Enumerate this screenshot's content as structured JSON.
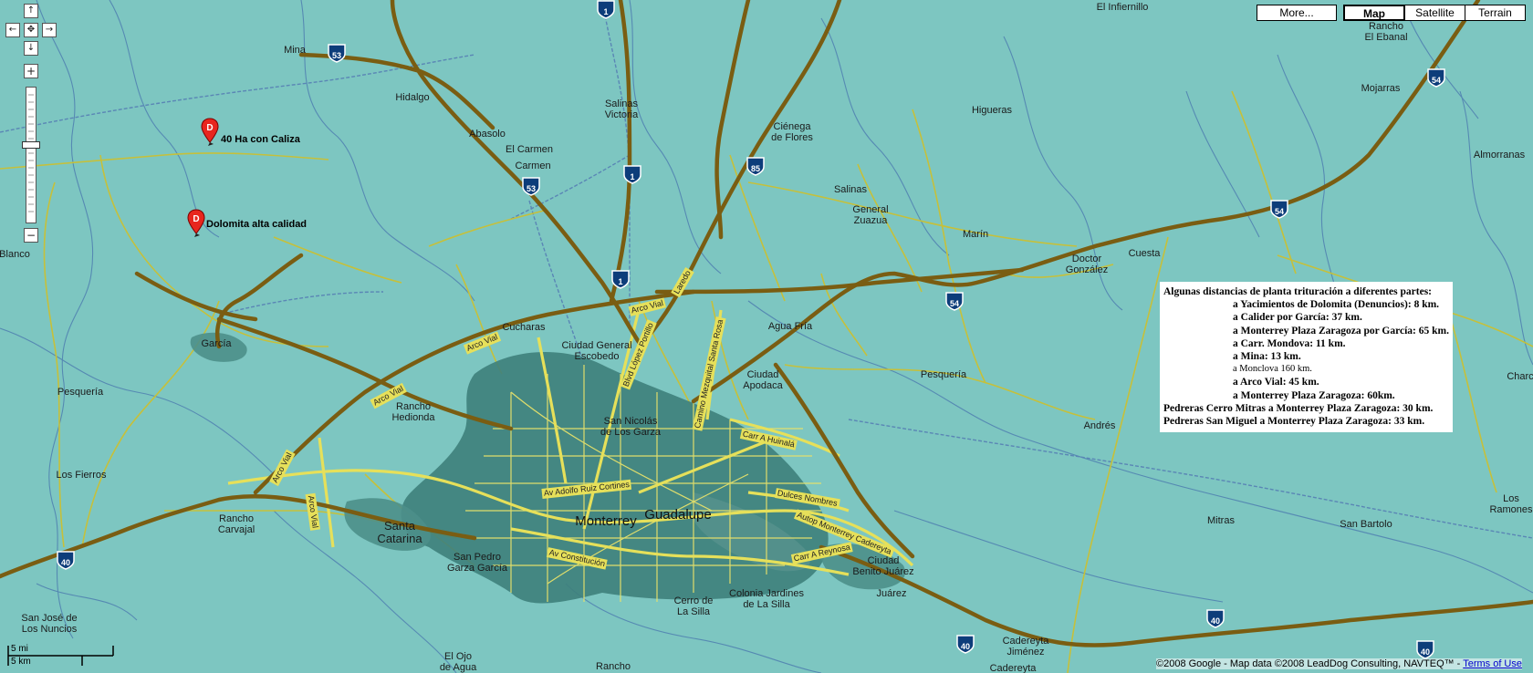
{
  "controls": {
    "pan_up": "↑",
    "pan_left": "←",
    "pan_center": "✥",
    "pan_right": "→",
    "pan_down": "↓",
    "zoom_in": "+",
    "zoom_out": "−"
  },
  "map_types": {
    "more": "More...",
    "map": "Map",
    "satellite": "Satellite",
    "terrain": "Terrain",
    "selected": "Map"
  },
  "markers": [
    {
      "letter": "D",
      "label": "40 Ha con Caliza"
    },
    {
      "letter": "D",
      "label": "Dolomita alta calidad"
    }
  ],
  "places": {
    "mina": "Mina",
    "hidalgo": "Hidalgo",
    "abasolo": "Abasolo",
    "el_carmen": "El Carmen",
    "carmen": "Carmen",
    "salinas_victoria_1": "Salinas",
    "salinas_victoria_2": "Victoria",
    "cienega_1": "Ciénega",
    "cienega_2": "de Flores",
    "el_infiernillo": "El Infiernillo",
    "rancho_el_ebanal_1": "Rancho",
    "rancho_el_ebanal_2": "El Ebanal",
    "mojarras": "Mojarras",
    "almorranas": "Almorranas",
    "higueras": "Higueras",
    "salinas": "Salinas",
    "general_zuazua_1": "General",
    "general_zuazua_2": "Zuazua",
    "marin": "Marín",
    "doctor_gonzalez_1": "Doctor",
    "doctor_gonzalez_2": "González",
    "cuesta": "Cuesta",
    "blanco": "Blanco",
    "garcia": "García",
    "cucharas": "Cucharas",
    "ciudad_escobedo_1": "Ciudad General",
    "ciudad_escobedo_2": "Escobedo",
    "agua_fria": "Agua Fría",
    "ciudad_apodaca_1": "Ciudad",
    "ciudad_apodaca_2": "Apodaca",
    "pesqueria_e": "Pesquería",
    "pesqueria_w": "Pesquería",
    "rancho_hedionda_1": "Rancho",
    "rancho_hedionda_2": "Hedionda",
    "san_nicolas_1": "San Nicolás",
    "san_nicolas_2": "de Los Garza",
    "andres": "Andrés",
    "los_fierros": "Los Fierros",
    "rancho_carvajal_1": "Rancho",
    "rancho_carvajal_2": "Carvajal",
    "santa_catarina_1": "Santa",
    "santa_catarina_2": "Catarina",
    "monterrey": "Monterrey",
    "guadalupe": "Guadalupe",
    "san_pedro_1": "San Pedro",
    "san_pedro_2": "Garza García",
    "ciudad_benito_juarez_1": "Ciudad",
    "ciudad_benito_juarez_2": "Benito Juárez",
    "juarez": "Juárez",
    "cerro_silla_1": "Cerro de",
    "cerro_silla_2": "La Silla",
    "colonia_jardines_1": "Colonia Jardines",
    "colonia_jardines_2": "de La Silla",
    "mitras": "Mitras",
    "san_bartolo": "San Bartolo",
    "los_ramones_1": "Los",
    "los_ramones_2": "Ramones",
    "charco": "Charc",
    "san_jose_1": "San José de",
    "san_jose_2": "Los Nuncios",
    "el_ojo_1": "El Ojo",
    "el_ojo_2": "de Agua",
    "rancho_s": "Rancho",
    "cadereyta_1": "Cadereyta",
    "cadereyta_2": "Jiménez",
    "cadereyta_3": "Cadereyta"
  },
  "highways": {
    "h1a": "1",
    "h1b": "1",
    "h1c": "1",
    "h53a": "53",
    "h53b": "53",
    "h85": "85",
    "h54a": "54",
    "h54b": "54",
    "h54c": "54",
    "h40a": "40",
    "h40b": "40",
    "h40c": "40",
    "h40d": "40"
  },
  "road_labels": {
    "arco_vial_1": "Arco Vial",
    "arco_vial_2": "Arco Vial",
    "arco_vial_3": "Arco Vial",
    "arco_vial_4": "Arco Vial",
    "arco_vial_5": "Arco Vial",
    "laredo": "Laredo",
    "lopez_portillo": "Blvd López Portillo",
    "santa_rosa": "Camino Mezquital Santa Rosa",
    "huinala": "Carr A Huinalá",
    "dulces_nombres": "Dulces Nombres",
    "cadereyta_auto": "Autop Monterrey Cadereyta",
    "reynosa": "Carr A Reynosa",
    "ruiz_cortines": "Av Adolfo Ruiz Cortines",
    "constitucion": "Av Constitución"
  },
  "info_panel": {
    "lines": [
      "Algunas distancias de  planta trituración a diferentes partes:",
      "a Yacimientos de Dolomita (Denuncios): 8 km.",
      "a Calider por García: 37 km.",
      "a Monterrey Plaza Zaragoza por García: 65 km.",
      "a Carr. Mondova: 11 km.",
      "a Mina: 13 km.",
      "a Monclova 160 km.",
      "a Arco Vial: 45 km.",
      "a Monterrey Plaza Zaragoza: 60km.",
      "Pedreras Cerro Mitras a Monterrey Plaza Zaragoza: 30 km.",
      "Pedreras San Miguel a Monterrey Plaza Zaragoza: 33 km."
    ]
  },
  "scale": {
    "mi": "5 mi",
    "km": "5 km"
  },
  "copyright": {
    "text": "©2008 Google - Map data ©2008 LeadDog Consulting, NAVTEQ™ - ",
    "terms": "Terms of Use"
  },
  "colors": {
    "water_bg": "#7dc6c1",
    "highway": "#7a5d12",
    "major_road": "#e6e05a",
    "urban": "#3e7f7b",
    "marker": "#e8261e"
  }
}
